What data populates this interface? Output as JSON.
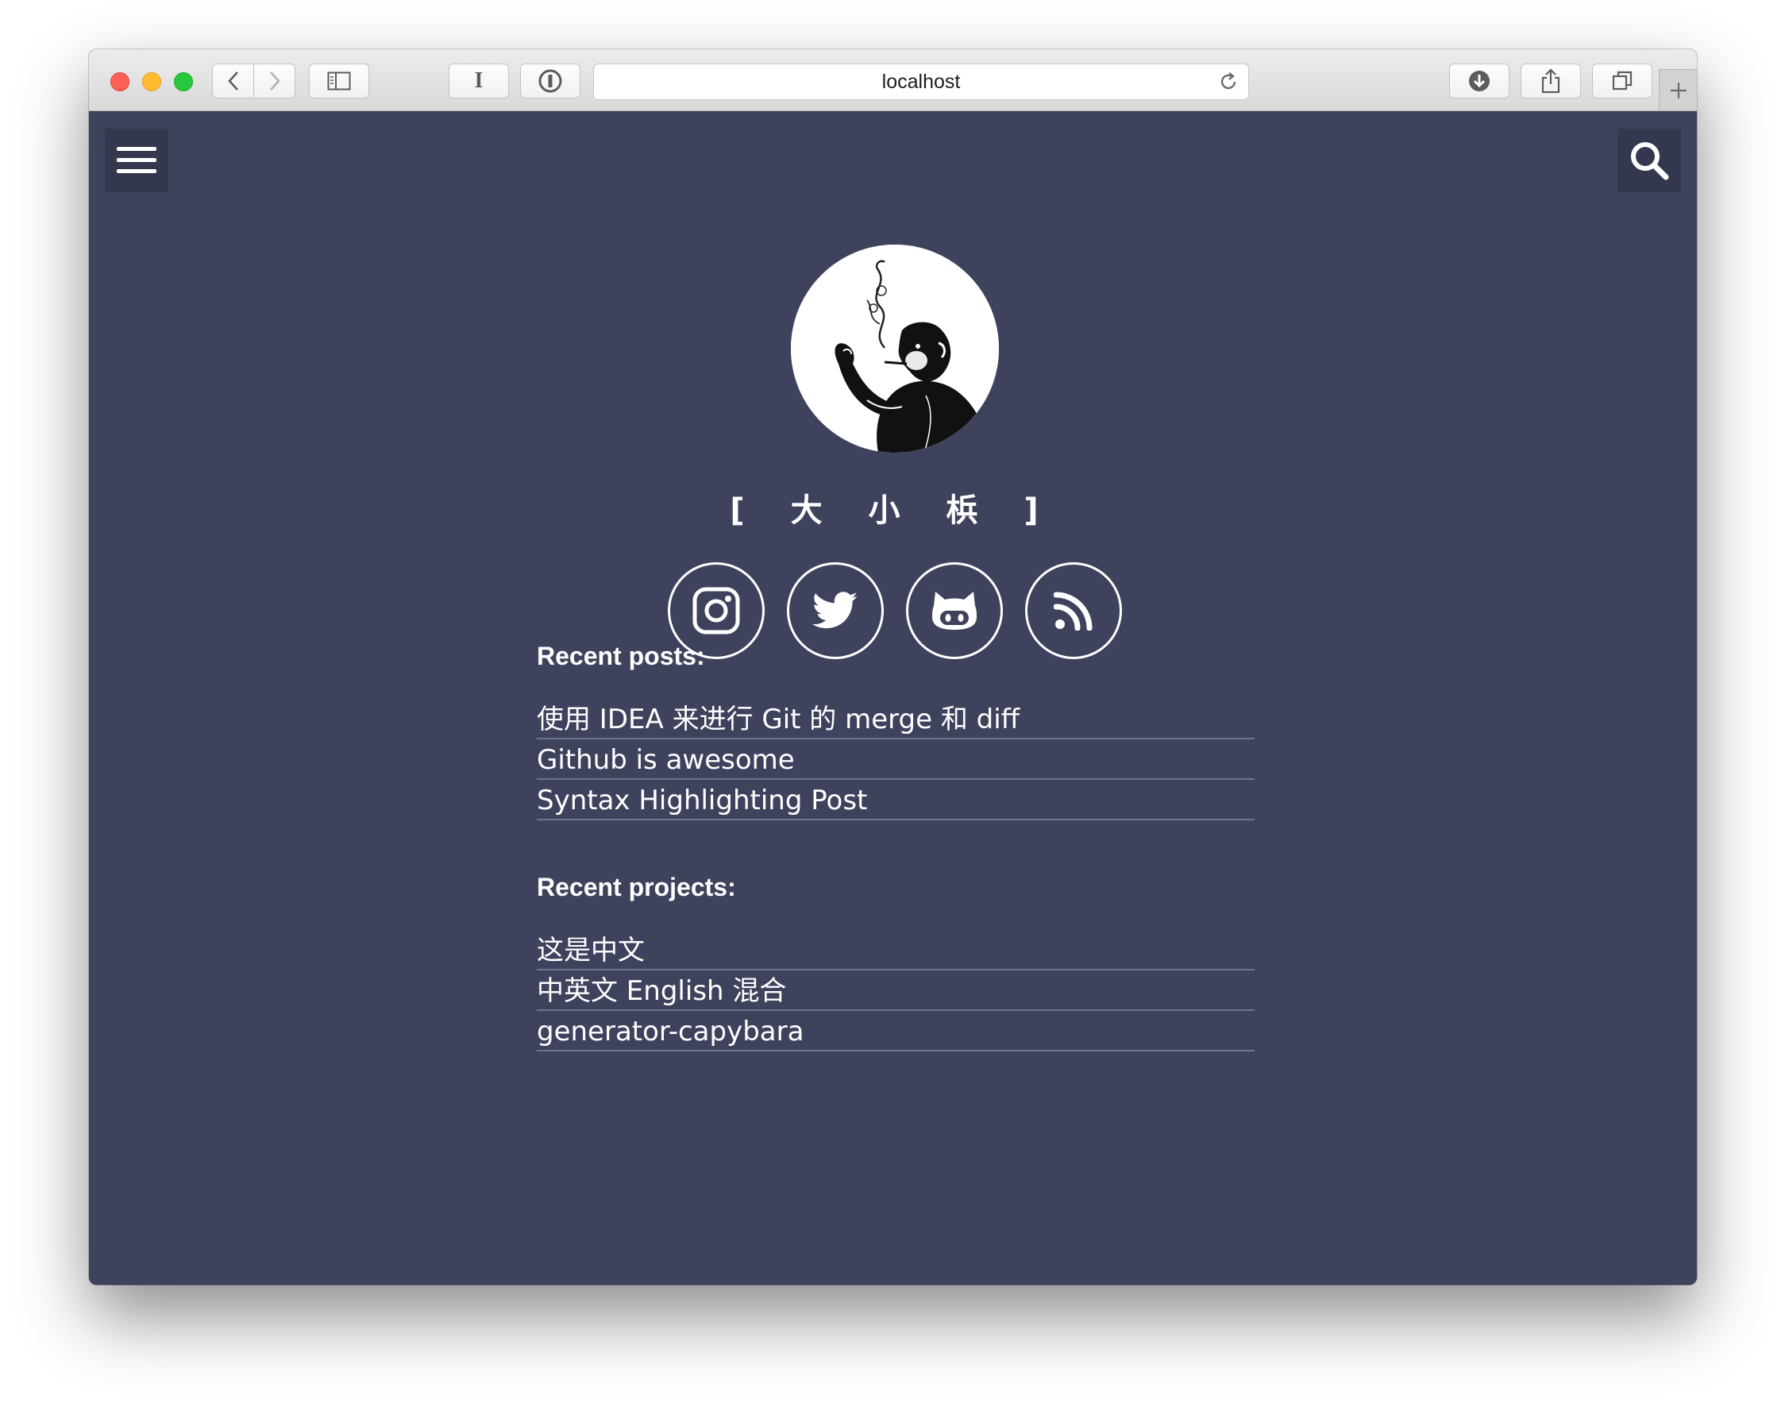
{
  "browser": {
    "url": "localhost",
    "reader_button_label": "I"
  },
  "header": {
    "menu_icon": "hamburger-menu-icon",
    "search_icon": "search-icon"
  },
  "profile": {
    "site_title": "[ 大 小 梹 ]",
    "avatar_icon": "monkey-avatar-icon"
  },
  "socials": [
    {
      "icon": "instagram-icon"
    },
    {
      "icon": "twitter-icon"
    },
    {
      "icon": "github-icon"
    },
    {
      "icon": "rss-icon"
    }
  ],
  "recent_posts": {
    "heading": "Recent posts:",
    "items": [
      "使用 IDEA 来进行 Git 的 merge 和 diff",
      "Github is awesome",
      "Syntax Highlighting Post"
    ]
  },
  "recent_projects": {
    "heading": "Recent projects:",
    "items": [
      "这是中文",
      "中英文 English 混合",
      "generator-capybara"
    ]
  },
  "colors": {
    "background": "#3e425c",
    "corner_button": "#34384f",
    "text": "#ffffff",
    "divider": "#6f7390"
  }
}
